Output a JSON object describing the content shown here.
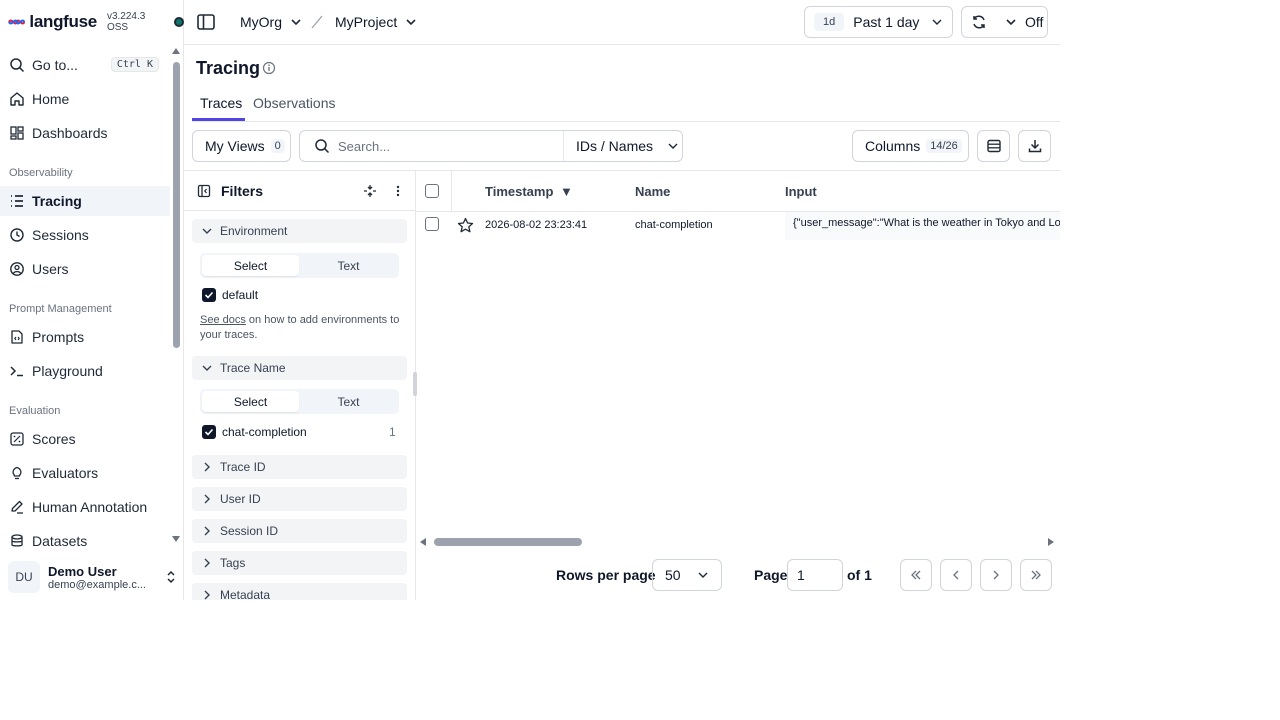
{
  "brand": {
    "name": "langfuse",
    "version": "v3.224.3 OSS"
  },
  "sidebar": {
    "goto_label": "Go to...",
    "goto_shortcut": "Ctrl K",
    "items": [
      {
        "label": "Home"
      },
      {
        "label": "Dashboards"
      },
      {
        "label": "Tracing"
      },
      {
        "label": "Sessions"
      },
      {
        "label": "Users"
      },
      {
        "label": "Prompts"
      },
      {
        "label": "Playground"
      },
      {
        "label": "Scores"
      },
      {
        "label": "Evaluators"
      },
      {
        "label": "Human Annotation"
      },
      {
        "label": "Datasets"
      }
    ],
    "sections": [
      "Observability",
      "Prompt Management",
      "Evaluation"
    ],
    "active": "Tracing"
  },
  "user": {
    "initials": "DU",
    "name": "Demo User",
    "email": "demo@example.c..."
  },
  "header": {
    "org": "MyOrg",
    "project": "MyProject",
    "range_badge": "1d",
    "range_label": "Past 1 day",
    "refresh_label": "Off"
  },
  "page": {
    "title": "Tracing",
    "tabs": [
      "Traces",
      "Observations"
    ],
    "active_tab": "Traces"
  },
  "toolbar": {
    "my_views_label": "My Views",
    "my_views_count": "0",
    "search_placeholder": "Search...",
    "search_mode": "IDs / Names",
    "columns_label": "Columns",
    "columns_count": "14/26"
  },
  "filters": {
    "title": "Filters",
    "environment": {
      "label": "Environment",
      "modes": [
        "Select",
        "Text"
      ],
      "option": "default",
      "help_link": "See docs",
      "help_text": " on how to add environments to your traces."
    },
    "trace_name": {
      "label": "Trace Name",
      "modes": [
        "Select",
        "Text"
      ],
      "option": "chat-completion",
      "count": "1"
    },
    "collapsed": [
      "Trace ID",
      "User ID",
      "Session ID",
      "Tags",
      "Metadata"
    ]
  },
  "table": {
    "columns": [
      "Timestamp",
      "Name",
      "Input"
    ],
    "sort_indicator": "▼",
    "rows": [
      {
        "timestamp": "2026-08-02 23:23:41",
        "name": "chat-completion",
        "input": "{\"user_message\":\"What is the weather in Tokyo and Lo"
      }
    ]
  },
  "pagination": {
    "rows_per_page_label": "Rows per page",
    "rows_per_page": "50",
    "page_label": "Page",
    "page_value": "1",
    "of_label": "of 1"
  }
}
